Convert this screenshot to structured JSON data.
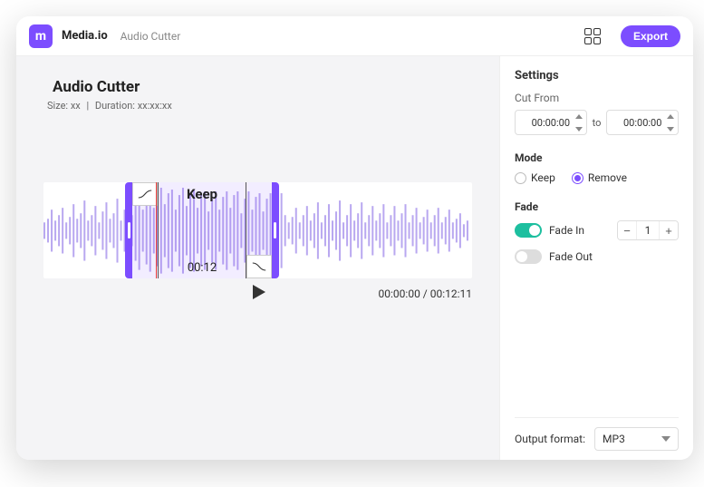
{
  "brand": "Media.io",
  "breadcrumb": "Audio Cutter",
  "export_label": "Export",
  "title": "Audio Cutter",
  "meta_size_label": "Size:",
  "meta_size_value": "xx",
  "meta_duration_label": "Duration:",
  "meta_duration_value": "xx:xx:xx",
  "selection": {
    "label": "Keep",
    "time": "00:12"
  },
  "playback": {
    "current": "00:00:00",
    "total": "00:12:11"
  },
  "settings": {
    "heading": "Settings",
    "cut_from_label": "Cut From",
    "from_value": "00:00:00",
    "to_label": "to",
    "to_value": "00:00:00",
    "mode_label": "Mode",
    "mode_keep": "Keep",
    "mode_remove": "Remove",
    "fade_label": "Fade",
    "fade_in_label": "Fade In",
    "fade_in_value": "1",
    "fade_out_label": "Fade Out",
    "output_label": "Output format:",
    "output_value": "MP3"
  }
}
